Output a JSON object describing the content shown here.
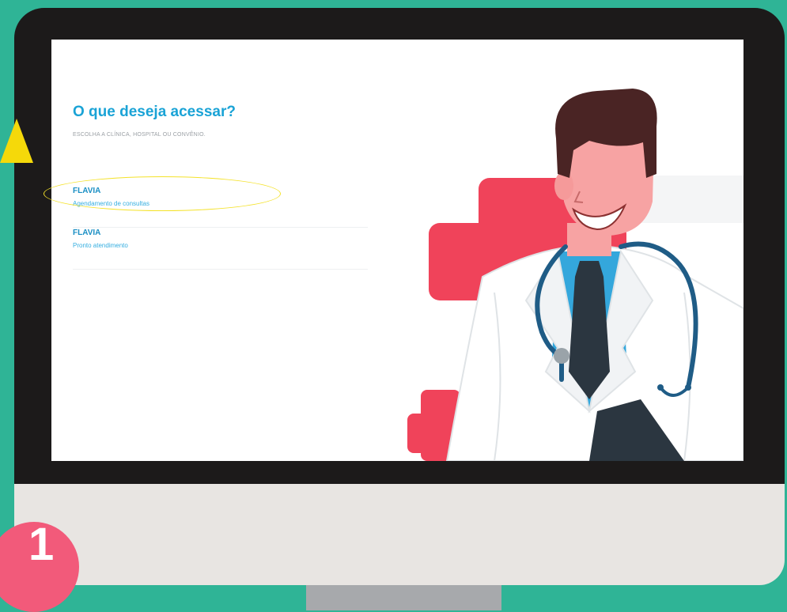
{
  "page": {
    "title": "O que deseja acessar?",
    "subtitle": "ESCOLHA A CLÍNICA, HOSPITAL OU CONVÊNIO."
  },
  "options": [
    {
      "name": "FLAVIA",
      "description": "Agendamento de consultas"
    },
    {
      "name": "FLAVIA",
      "description": "Pronto atendimento"
    }
  ],
  "step": {
    "number": "1"
  },
  "colors": {
    "background": "#2fb496",
    "bezel": "#1c1a1a",
    "chin": "#e8e5e2",
    "accent": "#1aa3d6",
    "cross": "#f0435a",
    "highlight": "#f4e22a",
    "badge": "#f25a7a"
  },
  "icons": [
    "doctor-illustration",
    "medical-cross-icon",
    "stethoscope-icon"
  ]
}
